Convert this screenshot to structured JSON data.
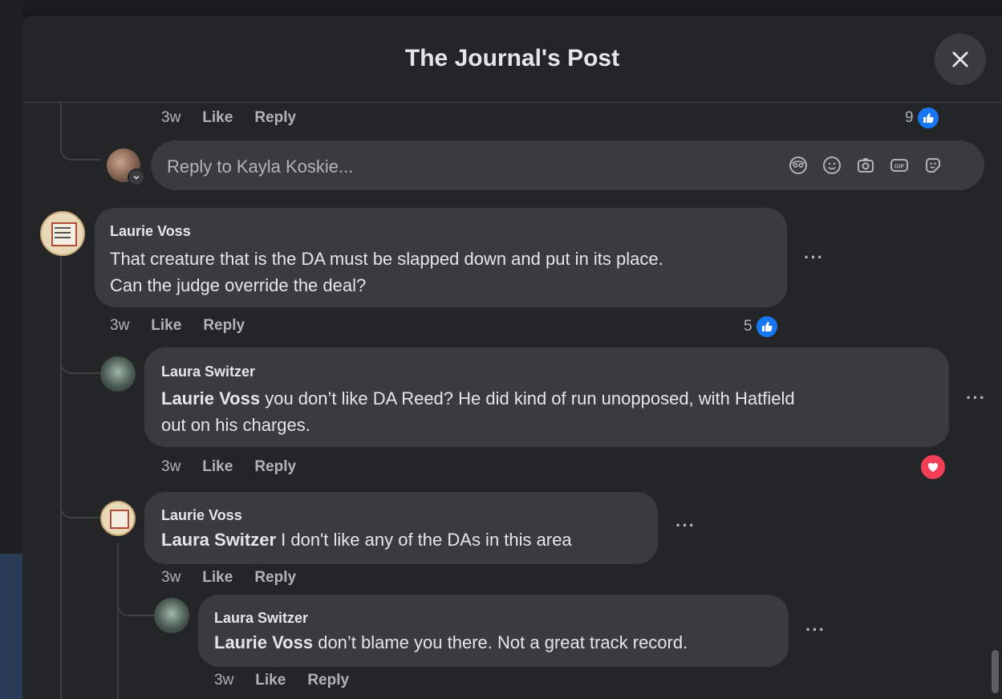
{
  "modal": {
    "title": "The Journal's Post",
    "close_icon": "close-icon"
  },
  "top_meta": {
    "time": "3w",
    "like": "Like",
    "reply": "Reply",
    "count": "9"
  },
  "reply_box": {
    "placeholder": "Reply to Kayla Koskie...",
    "icons": [
      "avatar-sticker-icon",
      "emoji-icon",
      "camera-icon",
      "gif-icon",
      "sticker-icon"
    ]
  },
  "comments": [
    {
      "author": "Laurie Voss",
      "line1": "That creature that is the DA must be slapped down and put in its place.",
      "line2": "Can the judge override the deal?",
      "time": "3w",
      "like": "Like",
      "reply": "Reply",
      "count": "5",
      "reaction": "like"
    },
    {
      "author": "Laura Switzer",
      "mention": "Laurie Voss",
      "line1": " you don’t like DA Reed? He did kind of run unopposed, with Hatfield",
      "line2": "out on his charges.",
      "time": "3w",
      "like": "Like",
      "reply": "Reply",
      "reaction": "love"
    },
    {
      "author": "Laurie Voss",
      "mention": "Laura Switzer",
      "line1": " I don't like any of the DAs in this area",
      "time": "3w",
      "like": "Like",
      "reply": "Reply"
    },
    {
      "author": "Laura Switzer",
      "mention": "Laurie Voss",
      "line1": " don’t blame you there. Not a great track record.",
      "time": "3w",
      "like": "Like",
      "reply": "Reply"
    }
  ],
  "more_label": "···",
  "colors": {
    "accent": "#1877f2",
    "love": "#f33e58",
    "bubble": "#3a3b3c"
  }
}
